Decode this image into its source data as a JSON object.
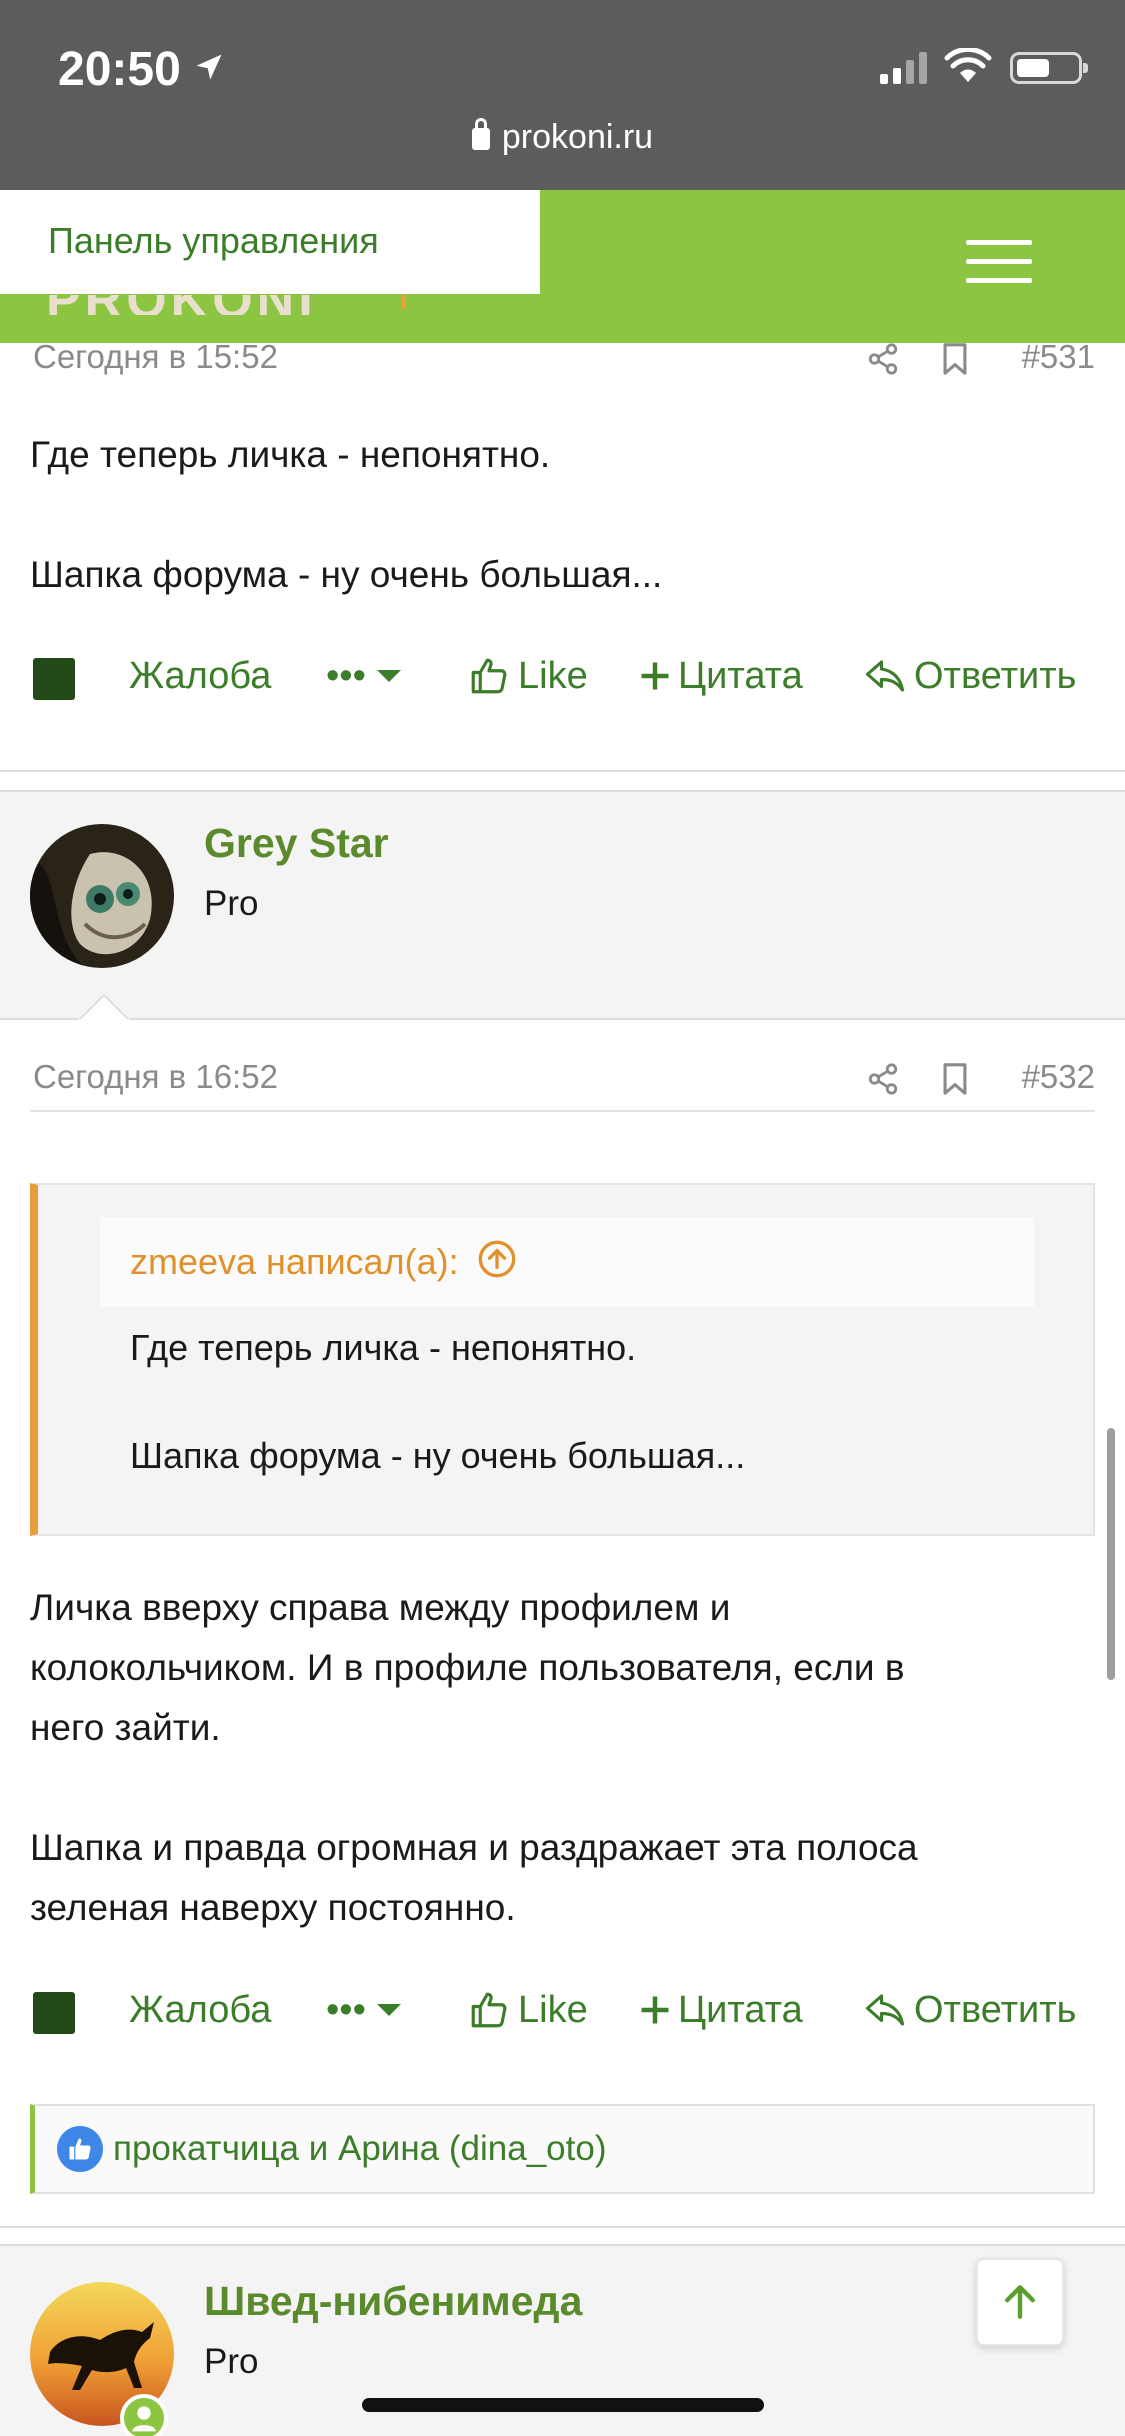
{
  "status_bar": {
    "time": "20:50",
    "url": "prokoni.ru"
  },
  "header": {
    "panel_label": "Панель управления",
    "logo_text": "PROKONI",
    "accent_color": "#8bc541"
  },
  "posts": [
    {
      "date": "Сегодня в 15:52",
      "number": "#531",
      "lines": [
        "Где теперь личка - непонятно.",
        "Шапка форума - ну очень большая..."
      ]
    },
    {
      "author": "Grey Star",
      "author_title": "Pro",
      "date": "Сегодня в 16:52",
      "number": "#532",
      "quote": {
        "head": "zmeeva написал(а):",
        "lines": [
          "Где теперь личка - непонятно.",
          "Шапка форума - ну очень большая..."
        ]
      },
      "lines": [
        "Личка вверху справа между профилем и",
        "колокольчиком. И в профиле пользователя, если в",
        "него зайти.",
        "Шапка и правда огромная и раздражает эта полоса",
        "зеленая наверху постоянно."
      ],
      "reactions_text": "прокатчица и Арина (dina_oto)"
    },
    {
      "author": "Швед-нибенимеда",
      "author_title": "Pro"
    }
  ],
  "actions": {
    "report": "Жалоба",
    "more": "•••",
    "like": "Like",
    "quote": "Цитата",
    "reply": "Ответить"
  }
}
